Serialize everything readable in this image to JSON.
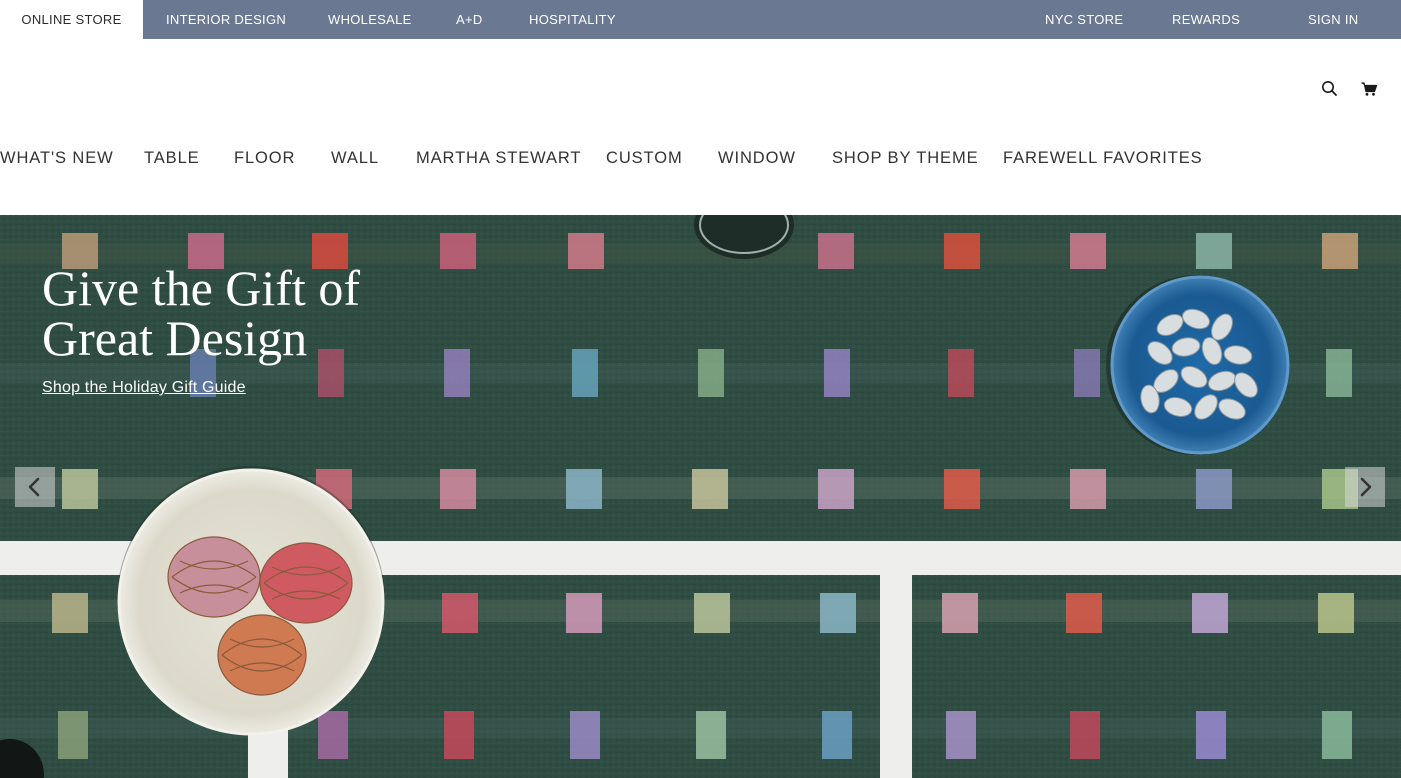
{
  "topbar": {
    "left_tabs": [
      {
        "label": "ONLINE STORE",
        "active": true
      },
      {
        "label": "INTERIOR DESIGN",
        "active": false
      },
      {
        "label": "WHOLESALE",
        "active": false
      },
      {
        "label": "A+D",
        "active": false
      },
      {
        "label": "HOSPITALITY",
        "active": false
      }
    ],
    "right_links": [
      {
        "label": "NYC STORE"
      },
      {
        "label": "REWARDS"
      },
      {
        "label": "SIGN IN"
      }
    ],
    "background_color": "#6b7891"
  },
  "header": {
    "icons": [
      "search-icon",
      "cart-icon"
    ]
  },
  "main_nav": {
    "items": [
      {
        "label": "WHAT'S NEW"
      },
      {
        "label": "TABLE"
      },
      {
        "label": "FLOOR"
      },
      {
        "label": "WALL"
      },
      {
        "label": "MARTHA STEWART"
      },
      {
        "label": "CUSTOM"
      },
      {
        "label": "WINDOW"
      },
      {
        "label": "SHOP BY THEME"
      },
      {
        "label": "FAREWELL FAVORITES"
      }
    ]
  },
  "hero": {
    "title_line1": "Give the Gift of",
    "title_line2": "Great Design",
    "cta_label": "Shop the Holiday Gift Guide",
    "prev_icon": "chevron-left-icon",
    "next_icon": "chevron-right-icon",
    "background_color": "#2f4d43"
  }
}
